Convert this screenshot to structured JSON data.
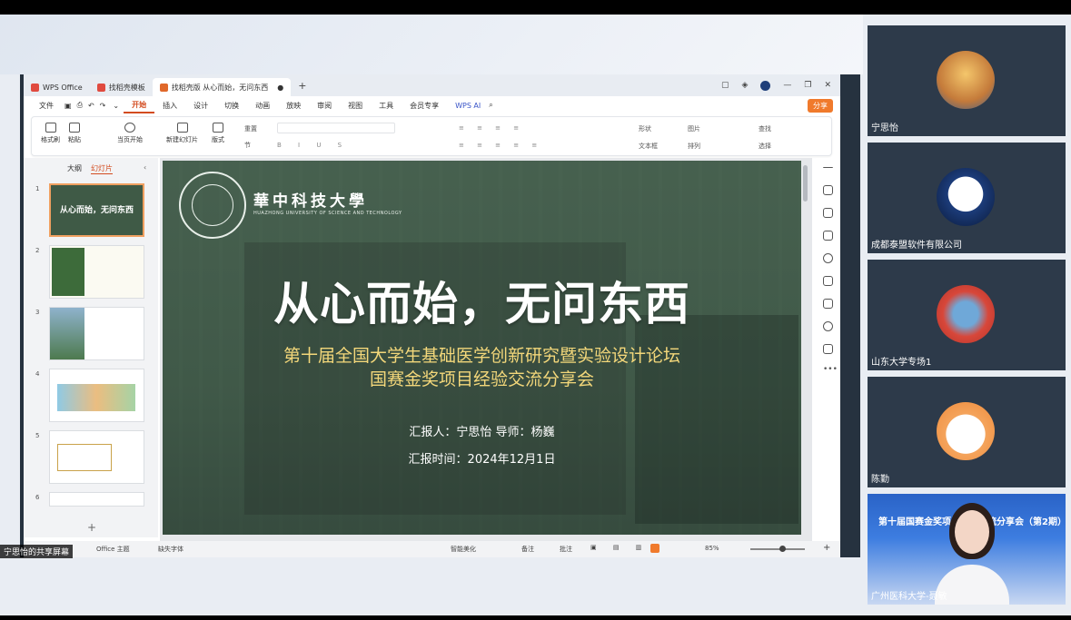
{
  "app": {
    "tabs": [
      {
        "label": "WPS Office",
        "color": "#e04a3f"
      },
      {
        "label": "找稻壳模板",
        "color": "#e04a3f"
      },
      {
        "label": "找稻壳版 从心而始，无问东西",
        "color": "#e0682a"
      }
    ],
    "menu": [
      "文件",
      "开始",
      "插入",
      "设计",
      "切换",
      "动画",
      "放映",
      "审阅",
      "视图",
      "工具",
      "会员专享",
      "WPS AI"
    ],
    "active_menu": "开始",
    "share_button": "分享",
    "ribbon": {
      "format_painter": "格式刷",
      "paste": "粘贴",
      "play_from_current": "当页开始",
      "new_slide": "新建幻灯片",
      "layout": "版式",
      "section": "节",
      "reset": "重置",
      "shape": "形状",
      "picture": "图片",
      "textbox": "文本框",
      "arrange": "排列",
      "find": "查找",
      "select": "选择"
    }
  },
  "left_panel": {
    "tab_outline": "大纲",
    "tab_slides": "幻灯片",
    "slide_numbers": [
      "1",
      "2",
      "3",
      "4",
      "5",
      "6"
    ],
    "add": "+"
  },
  "slide": {
    "university_cn": "華中科技大學",
    "university_en": "HUAZHONG UNIVERSITY OF SCIENCE AND TECHNOLOGY",
    "title": "从心而始，无问东西",
    "subtitle_1": "第十届全国大学生基础医学创新研究暨实验设计论坛",
    "subtitle_2": "国赛金奖项目经验交流分享会",
    "presenter": "汇报人：宁思怡  导师：杨巍",
    "date": "汇报时间：2024年12月1日"
  },
  "status_bar": {
    "theme": "Office 主题",
    "missing_font": "缺失字体",
    "smart_beautify": "智能美化",
    "notes": "备注",
    "comments": "批注",
    "zoom": "85%"
  },
  "share_label": "宁思怡的共享屏幕",
  "participants": [
    {
      "name": "宁思怡"
    },
    {
      "name": "成都泰盟软件有限公司"
    },
    {
      "name": "山东大学专场1"
    },
    {
      "name": "陈勤"
    },
    {
      "name": "广州医科大学-聂敏",
      "banner": "第十届国赛金奖项目经验交流分享会（第2期）"
    }
  ]
}
